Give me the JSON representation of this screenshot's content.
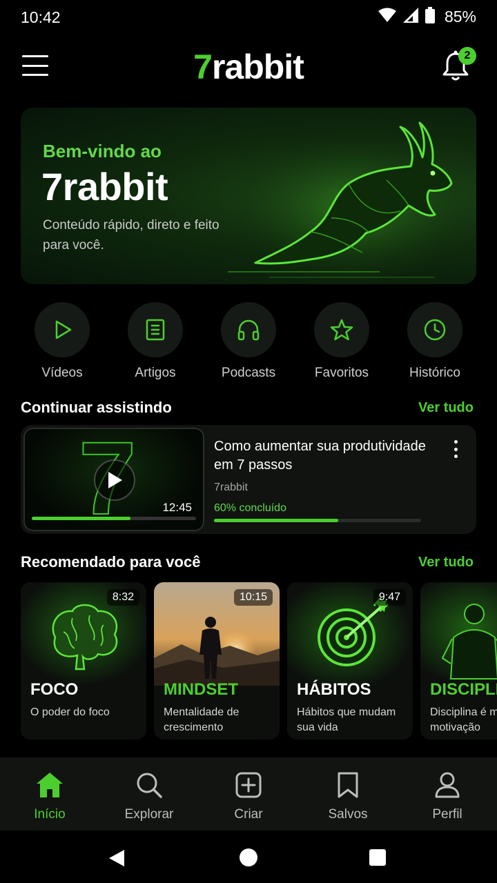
{
  "status_bar": {
    "time": "10:42",
    "battery": "85%"
  },
  "header": {
    "logo_prefix": "7",
    "logo_suffix": "rabbit",
    "notification_count": "2"
  },
  "hero": {
    "welcome": "Bem-vindo ao",
    "title": "7rabbit",
    "description": "Conteúdo rápido, direto e feito para você."
  },
  "quick_actions": [
    {
      "label": "Vídeos",
      "icon": "play-icon"
    },
    {
      "label": "Artigos",
      "icon": "document-icon"
    },
    {
      "label": "Podcasts",
      "icon": "headphones-icon"
    },
    {
      "label": "Favoritos",
      "icon": "star-icon"
    },
    {
      "label": "Histórico",
      "icon": "clock-icon"
    }
  ],
  "continue_section": {
    "title": "Continuar assistindo",
    "see_all": "Ver tudo",
    "item": {
      "title": "Como aumentar sua produtividade em 7 passos",
      "channel": "7rabbit",
      "duration": "12:45",
      "progress_text": "60% concluído",
      "progress": 0.6
    }
  },
  "recommended_section": {
    "title": "Recomendado para você",
    "see_all": "Ver tudo",
    "items": [
      {
        "tag": "FOCO",
        "subtitle": "O poder do foco",
        "duration": "8:32",
        "art": "brain-icon",
        "accent": "white"
      },
      {
        "tag": "MINDSET",
        "subtitle": "Mentalidade de crescimento",
        "duration": "10:15",
        "art": "person-sunset",
        "accent": "green"
      },
      {
        "tag": "HÁBITOS",
        "subtitle": "Hábitos que mudam sua vida",
        "duration": "9:47",
        "art": "target-icon",
        "accent": "white"
      },
      {
        "tag": "DISCIPLINA",
        "subtitle": "Disciplina é mais que motivação",
        "duration": "",
        "art": "warrior-figure",
        "accent": "green"
      }
    ]
  },
  "bottom_nav": [
    {
      "label": "Início",
      "icon": "home-icon",
      "active": true
    },
    {
      "label": "Explorar",
      "icon": "search-icon",
      "active": false
    },
    {
      "label": "Criar",
      "icon": "plus-square-icon",
      "active": false
    },
    {
      "label": "Salvos",
      "icon": "bookmark-icon",
      "active": false
    },
    {
      "label": "Perfil",
      "icon": "user-icon",
      "active": false
    }
  ],
  "colors": {
    "accent": "#4ccf2e",
    "background": "#000000",
    "surface": "#111311"
  }
}
